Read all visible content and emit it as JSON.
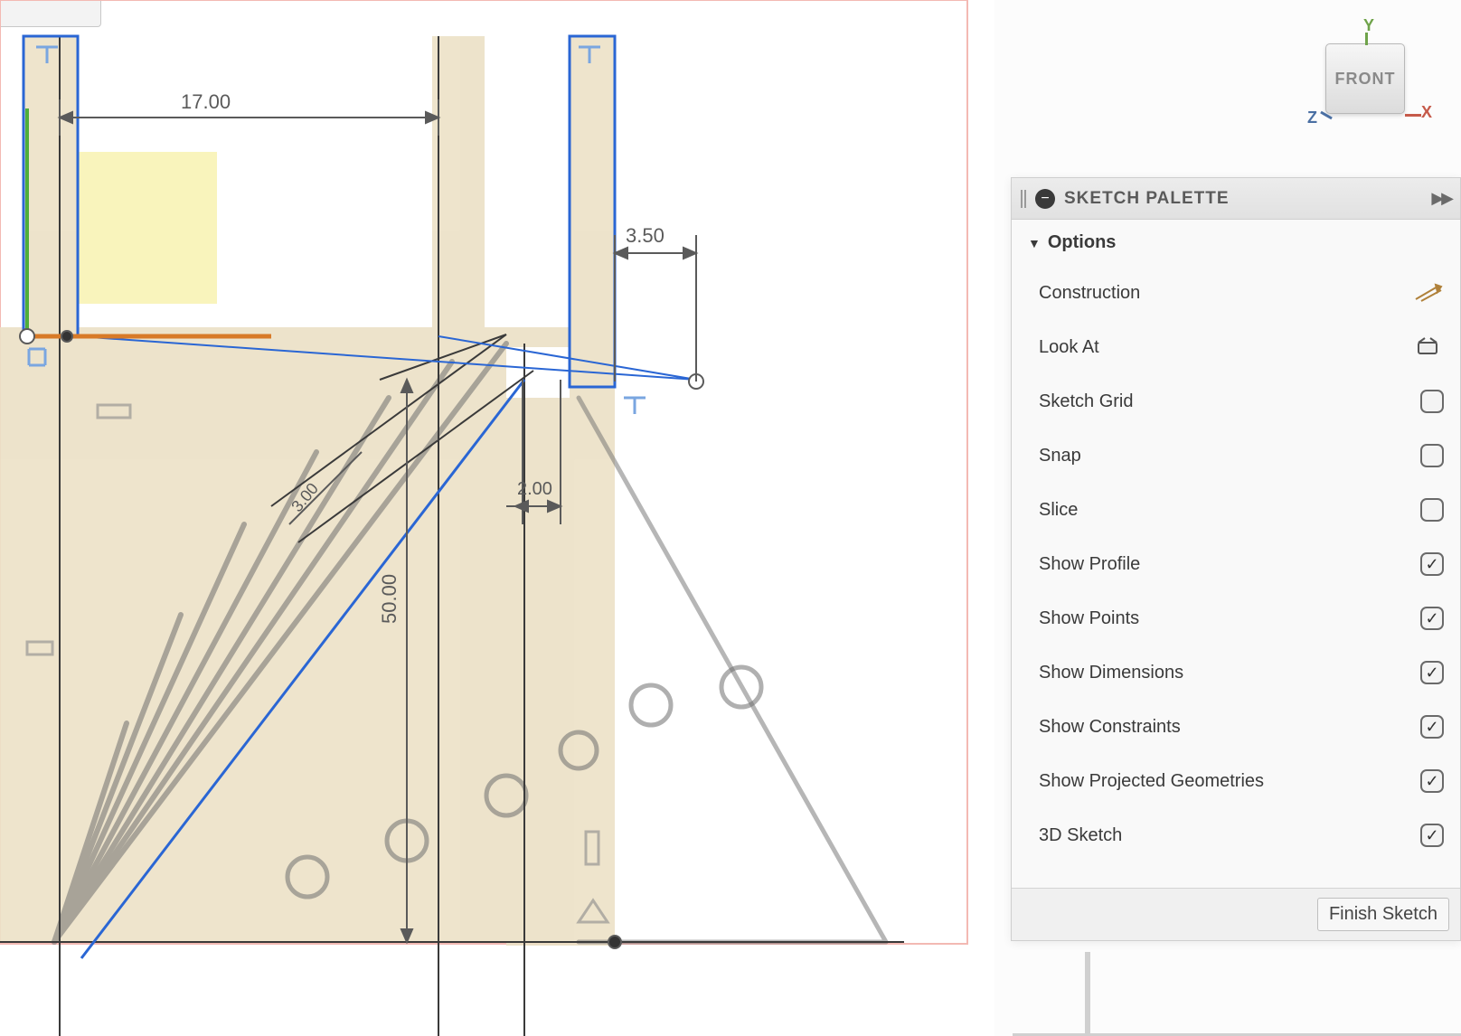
{
  "viewcube": {
    "face": "FRONT",
    "axes": {
      "x": "X",
      "y": "Y",
      "z": "Z"
    }
  },
  "dimensions": {
    "d1": "17.00",
    "d2": "3.50",
    "d3": "2.00",
    "d4": "50.00",
    "d5": "3.00"
  },
  "palette": {
    "title": "SKETCH PALETTE",
    "section": "Options",
    "options": [
      {
        "label": "Construction",
        "kind": "icon",
        "icon": "construction"
      },
      {
        "label": "Look At",
        "kind": "icon",
        "icon": "lookat"
      },
      {
        "label": "Sketch Grid",
        "kind": "check",
        "checked": false
      },
      {
        "label": "Snap",
        "kind": "check",
        "checked": false
      },
      {
        "label": "Slice",
        "kind": "check",
        "checked": false
      },
      {
        "label": "Show Profile",
        "kind": "check",
        "checked": true
      },
      {
        "label": "Show Points",
        "kind": "check",
        "checked": true
      },
      {
        "label": "Show Dimensions",
        "kind": "check",
        "checked": true
      },
      {
        "label": "Show Constraints",
        "kind": "check",
        "checked": true
      },
      {
        "label": "Show Projected Geometries",
        "kind": "check",
        "checked": true
      },
      {
        "label": "3D Sketch",
        "kind": "check",
        "checked": true
      }
    ],
    "finish": "Finish Sketch"
  }
}
